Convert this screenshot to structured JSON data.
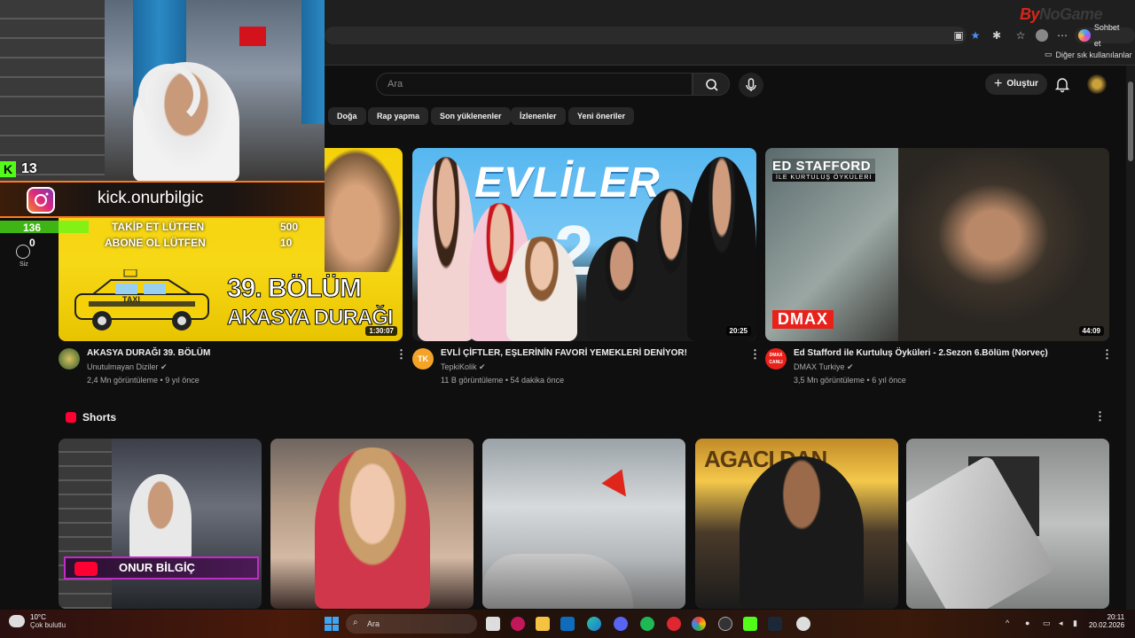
{
  "browser": {
    "brand_prefix": "By",
    "brand_suffix": "NoGame",
    "chat_button": "Sohbet et",
    "favorites_folder": "Diğer sık kullanılanlar"
  },
  "header": {
    "search_placeholder": "Ara",
    "create_label": "Oluştur"
  },
  "chips": [
    "Doğa",
    "Rap yapma",
    "Son yüklenenler",
    "İzlenenler",
    "Yeni öneriler"
  ],
  "sidebar": {
    "you_label": "Siz"
  },
  "videos": [
    {
      "title": "AKASYA DURAĞI 39. BÖLÜM",
      "channel": "Unutulmayan Diziler",
      "meta": "2,4 Mn görüntüleme • 9 yıl önce",
      "duration": "1:30:07",
      "thumb_text_ep": "39. BÖLÜM",
      "thumb_text_name": "AKASYA DURAĞI",
      "thumb_taxi": "TAXI"
    },
    {
      "title": "EVLİ ÇİFTLER, EŞLERİNİN FAVORİ YEMEKLERİ DENİYOR!",
      "channel": "TepkiKolik",
      "meta": "11 B görüntüleme • 54 dakika önce",
      "duration": "20:25",
      "thumb_text": "EVLİLER",
      "thumb_num": "2",
      "avatar_text": "TK"
    },
    {
      "title": "Ed Stafford ile Kurtuluş Öyküleri - 2.Sezon 6.Bölüm (Norveç)",
      "channel": "DMAX Turkiye",
      "meta": "3,5 Mn görüntüleme • 6 yıl önce",
      "duration": "44:09",
      "thumb_line1": "ED STAFFORD",
      "thumb_line2": "İLE KURTULUŞ ÖYKÜLERİ",
      "thumb_logo": "DMAX",
      "avatar_text": "DMAX CANLI"
    }
  ],
  "shorts": {
    "title": "Shorts",
    "short1_banner": "ONUR BİLGİÇ",
    "short4_text": "AGACI DAN"
  },
  "overlay": {
    "kick_count": "13",
    "kick_letter": "K",
    "social_handle": "kick.onurbilgic",
    "goal1_current": "136",
    "goal1_label": "TAKİP ET LÜTFEN",
    "goal1_target": "500",
    "goal1_progress": 0.272,
    "goal2_current": "0",
    "goal2_label": "ABONE OL LÜTFEN",
    "goal2_target": "10"
  },
  "taskbar": {
    "temp": "10°C",
    "weather": "Çok bulutlu",
    "search": "Ara",
    "time": "20:11",
    "date": "20.02.2026"
  },
  "colors": {
    "background": "#0f0f0f",
    "kick_green": "#53fc18",
    "youtube_red": "#ff0033",
    "dmax_red": "#e8221b"
  }
}
